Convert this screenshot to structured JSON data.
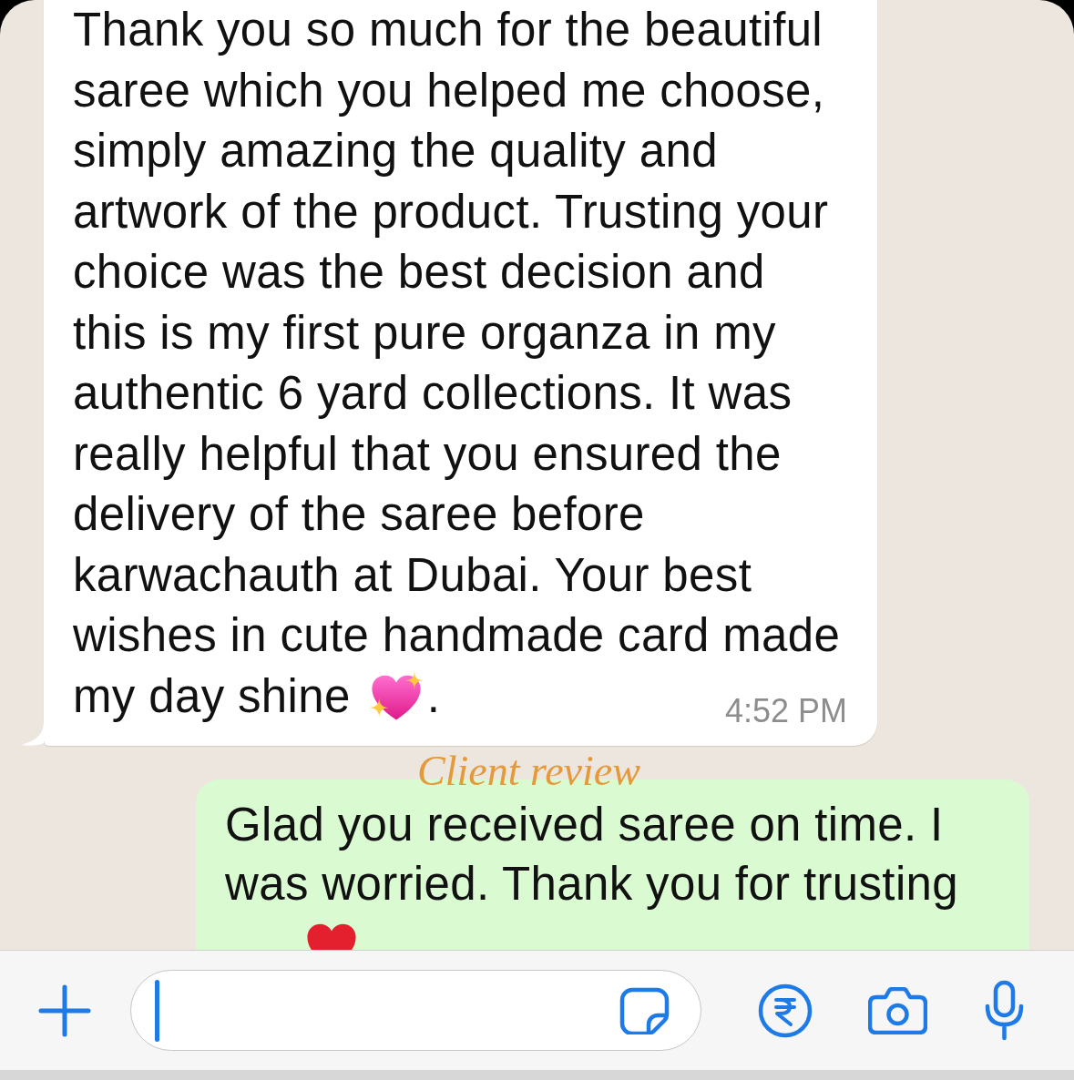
{
  "chat": {
    "messages": [
      {
        "kind": "incoming",
        "rows": [
          {
            "parts": [
              {
                "kind": "text",
                "text": "Thank you so much for the beautiful\nsaree which you helped me choose,\nsimply amazing the quality and\nartwork of the product. Trusting your\nchoice was the best decision and\nthis is my first pure organza in my\nauthentic 6 yard collections. It was\nreally helpful that you ensured the\ndelivery of the saree before\nkarwachauth at Dubai. Your best\nwishes in cute handmade card made"
              }
            ]
          },
          {
            "parts": [
              {
                "kind": "text",
                "text": "my day shine"
              },
              {
                "kind": "sparkleheart"
              },
              {
                "kind": "text",
                "text": "."
              }
            ]
          }
        ],
        "time": "4:52 PM"
      },
      {
        "kind": "outgoing",
        "rows": [
          {
            "parts": [
              {
                "kind": "text",
                "text": "Glad you received saree on time. I\nwas worried. Thank you for trusting"
              }
            ]
          },
          {
            "parts": [
              {
                "kind": "heart"
              }
            ]
          }
        ]
      }
    ],
    "caption": "Client review"
  },
  "composer": {
    "focused": true
  }
}
